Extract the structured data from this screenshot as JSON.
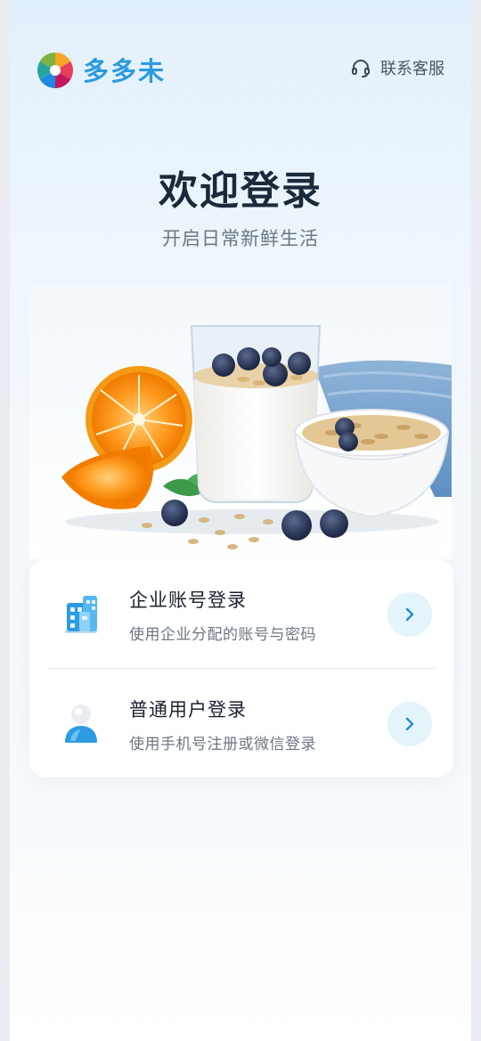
{
  "app": {
    "brand_name": "多多未",
    "logo_icon": "pinwheel-logo-icon",
    "brand_color": "#2a9be0"
  },
  "header": {
    "service_label": "联系客服",
    "service_icon": "headset-icon"
  },
  "welcome": {
    "title": "欢迎登录",
    "subtitle": "开启日常新鲜生活"
  },
  "hero": {
    "image": "yogurt-oats-blueberries-orange-photo"
  },
  "login_options": [
    {
      "title": "企业账号登录",
      "description": "使用企业分配的账号与密码",
      "icon": "office-building-icon",
      "action_icon": "chevron-right-icon"
    },
    {
      "title": "普通用户登录",
      "description": "使用手机号注册或微信登录",
      "icon": "user-person-icon",
      "action_icon": "chevron-right-icon"
    }
  ],
  "colors": {
    "accent": "#2a9be0",
    "arrow_button_bg": "#e3f4fb",
    "title_text": "#1a2a3b",
    "secondary_text": "#6b7785"
  }
}
